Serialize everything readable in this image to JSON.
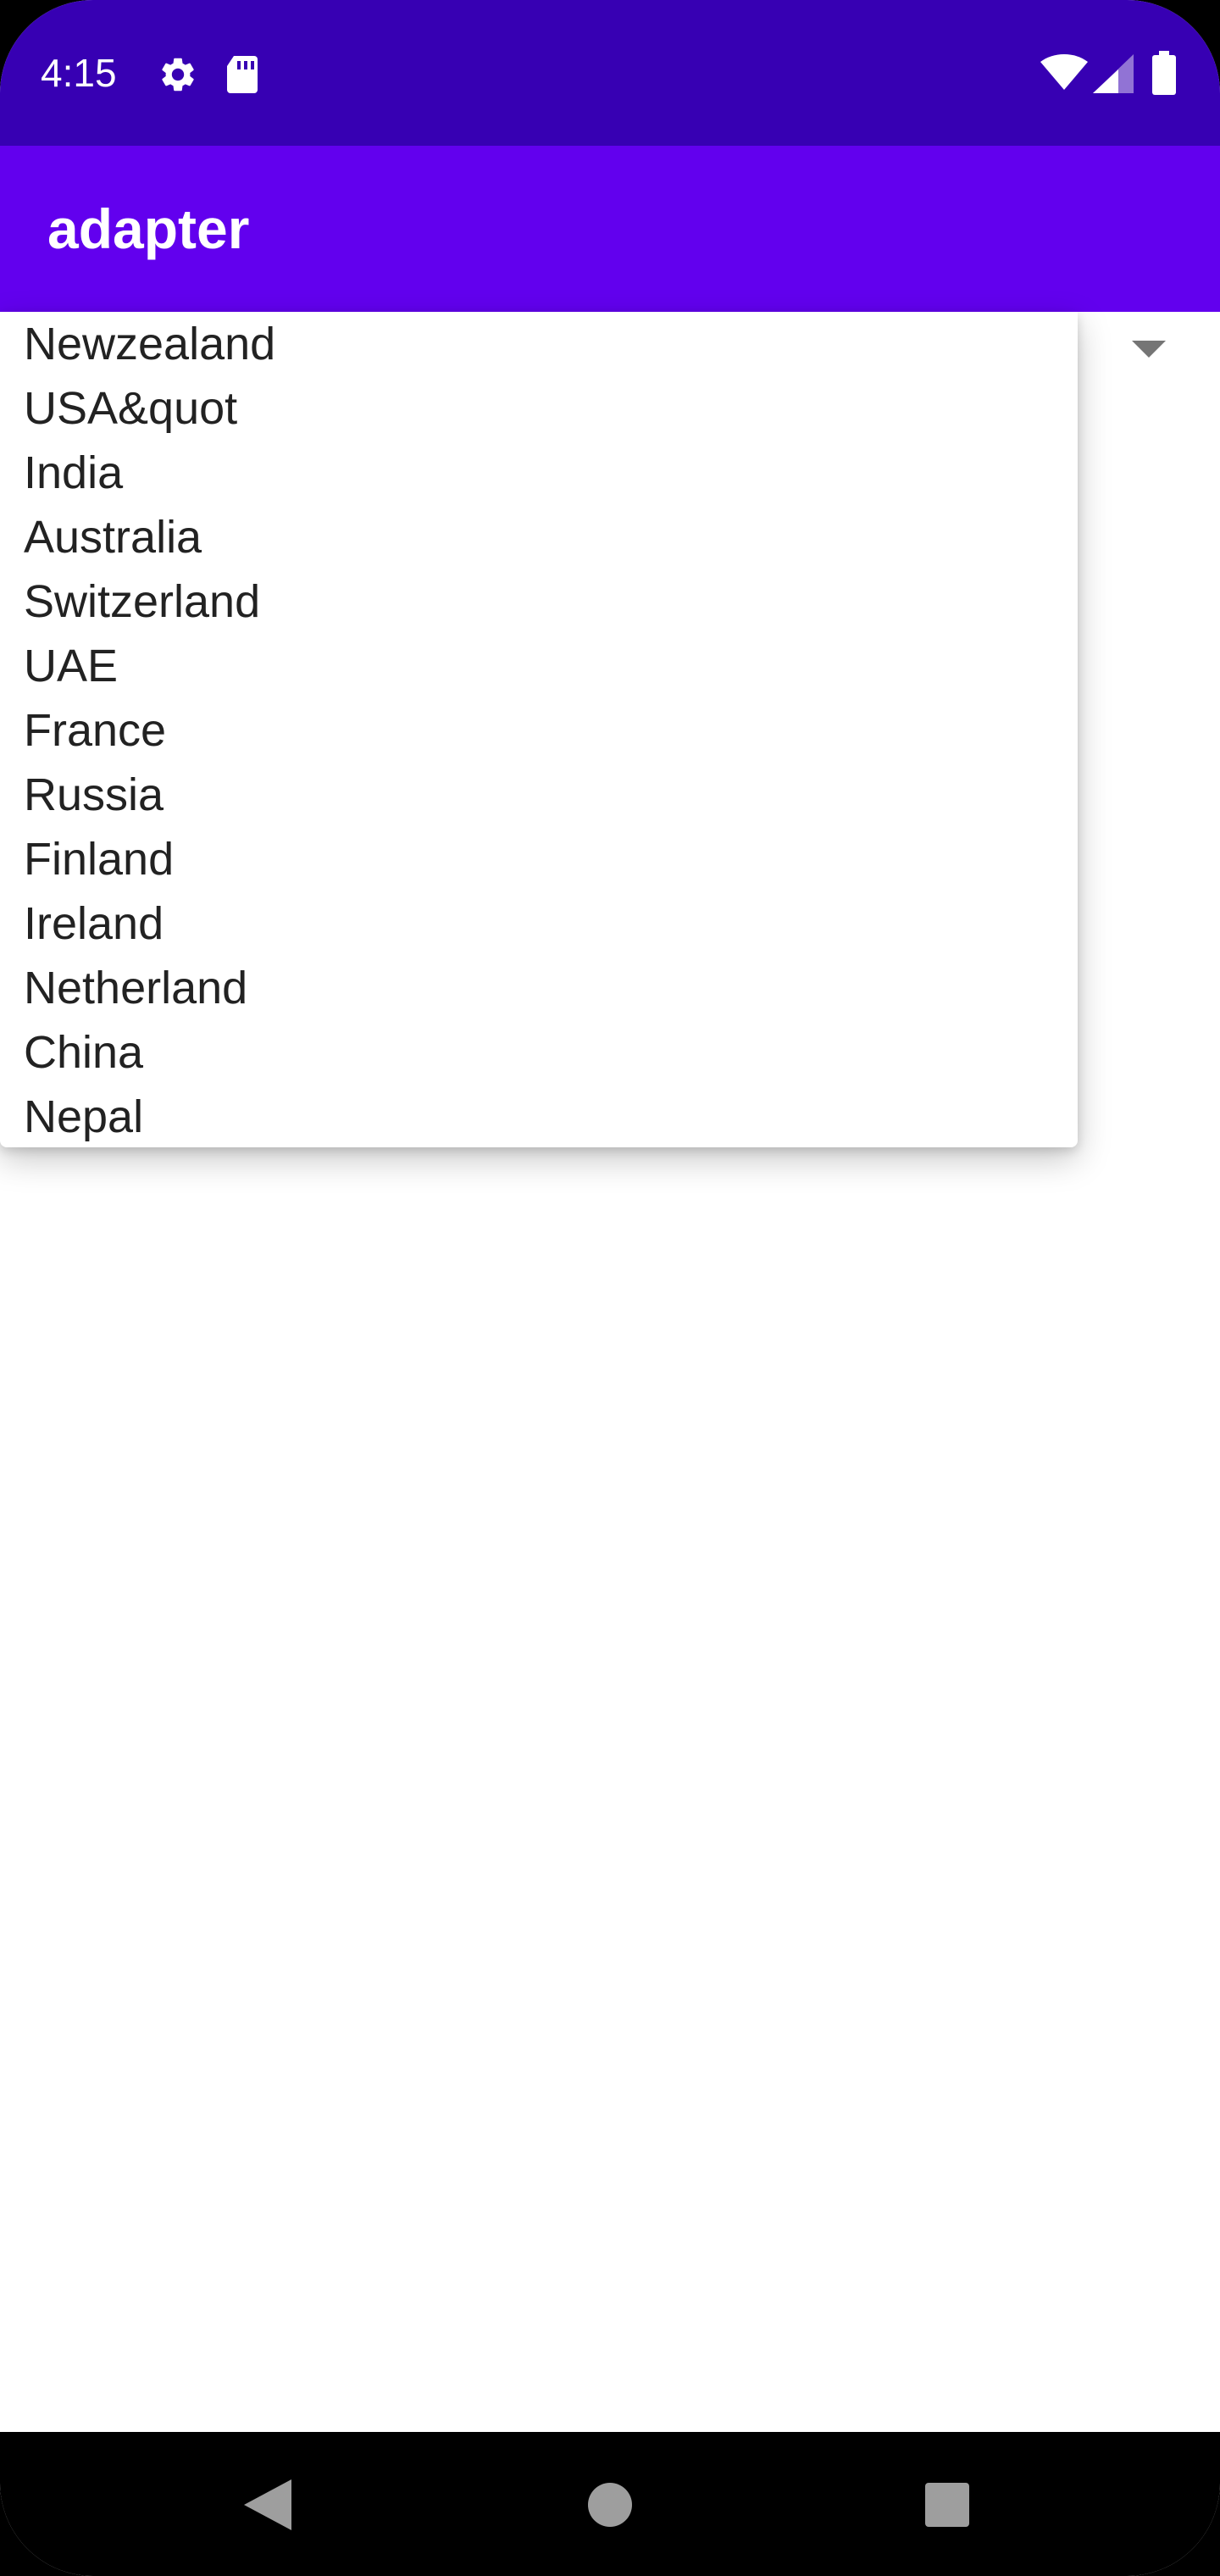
{
  "status_bar": {
    "time": "4:15",
    "icons": [
      "settings-gear-icon",
      "sd-card-icon",
      "wifi-icon",
      "cellular-signal-icon",
      "battery-icon"
    ],
    "background": "#3700b3"
  },
  "app_bar": {
    "title": "adapter",
    "background": "#6200ee"
  },
  "spinner": {
    "dropdown_open": true,
    "options": [
      "Newzealand",
      "USA&quot",
      "India",
      "Australia",
      "Switzerland",
      "UAE",
      "France",
      "Russia",
      "Finland",
      "Ireland",
      "Netherland",
      "China",
      "Nepal"
    ]
  },
  "nav_bar": {
    "buttons": [
      "back-icon",
      "home-icon",
      "recents-icon"
    ]
  }
}
